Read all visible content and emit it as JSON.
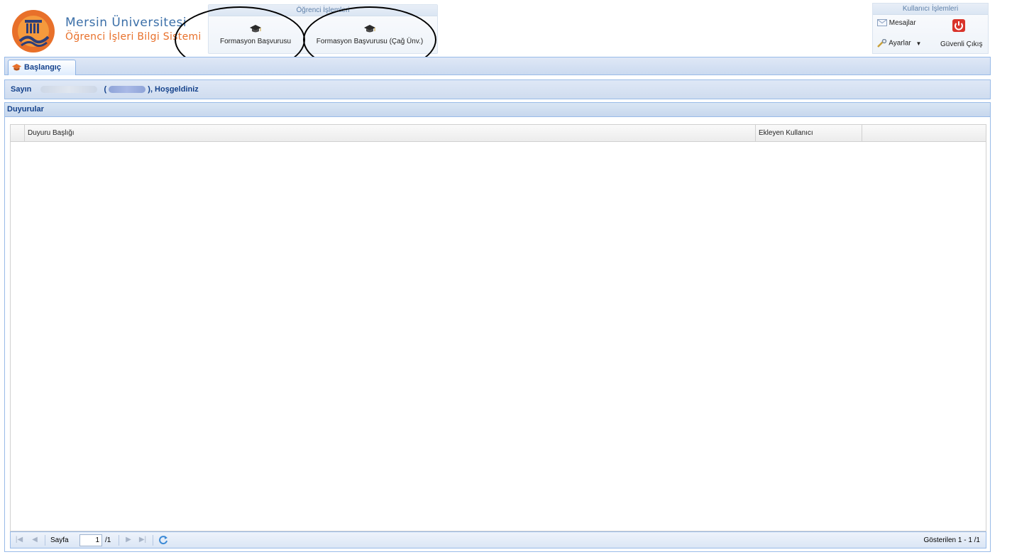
{
  "brand": {
    "title": "Mersin Üniversitesi",
    "subtitle": "Öğrenci İşleri Bilgi Sistemi"
  },
  "ogrenci_islemleri": {
    "title": "Öğrenci İşlemleri",
    "buttons": [
      {
        "label": "Formasyon Başvurusu",
        "icon": "graduation-cap-icon"
      },
      {
        "label": "Formasyon Başvurusu (Çağ Ünv.)",
        "icon": "graduation-cap-icon"
      }
    ]
  },
  "kullanici_islemleri": {
    "title": "Kullanıcı İşlemleri",
    "messages_label": "Mesajlar",
    "settings_label": "Ayarlar",
    "logout_label": "Güvenli Çıkış"
  },
  "tabs": [
    {
      "label": "Başlangıç",
      "active": true
    }
  ],
  "welcome": {
    "prefix": "Sayın",
    "open_paren": "(",
    "suffix": "), Hoşgeldiniz"
  },
  "announcements": {
    "panel_title": "Duyurular",
    "columns": [
      "Duyuru Başlığı",
      "Ekleyen Kullanıcı"
    ],
    "rows": []
  },
  "pager": {
    "page_label": "Sayfa",
    "current_page": "1",
    "total_pages": "/1",
    "status": "Gösterilen 1 - 1 /1"
  },
  "colors": {
    "brand_blue": "#3b6fa8",
    "brand_orange": "#e8702a",
    "panel_border": "#99bbe8",
    "header_text": "#15428b",
    "logout_red": "#d9342b"
  }
}
